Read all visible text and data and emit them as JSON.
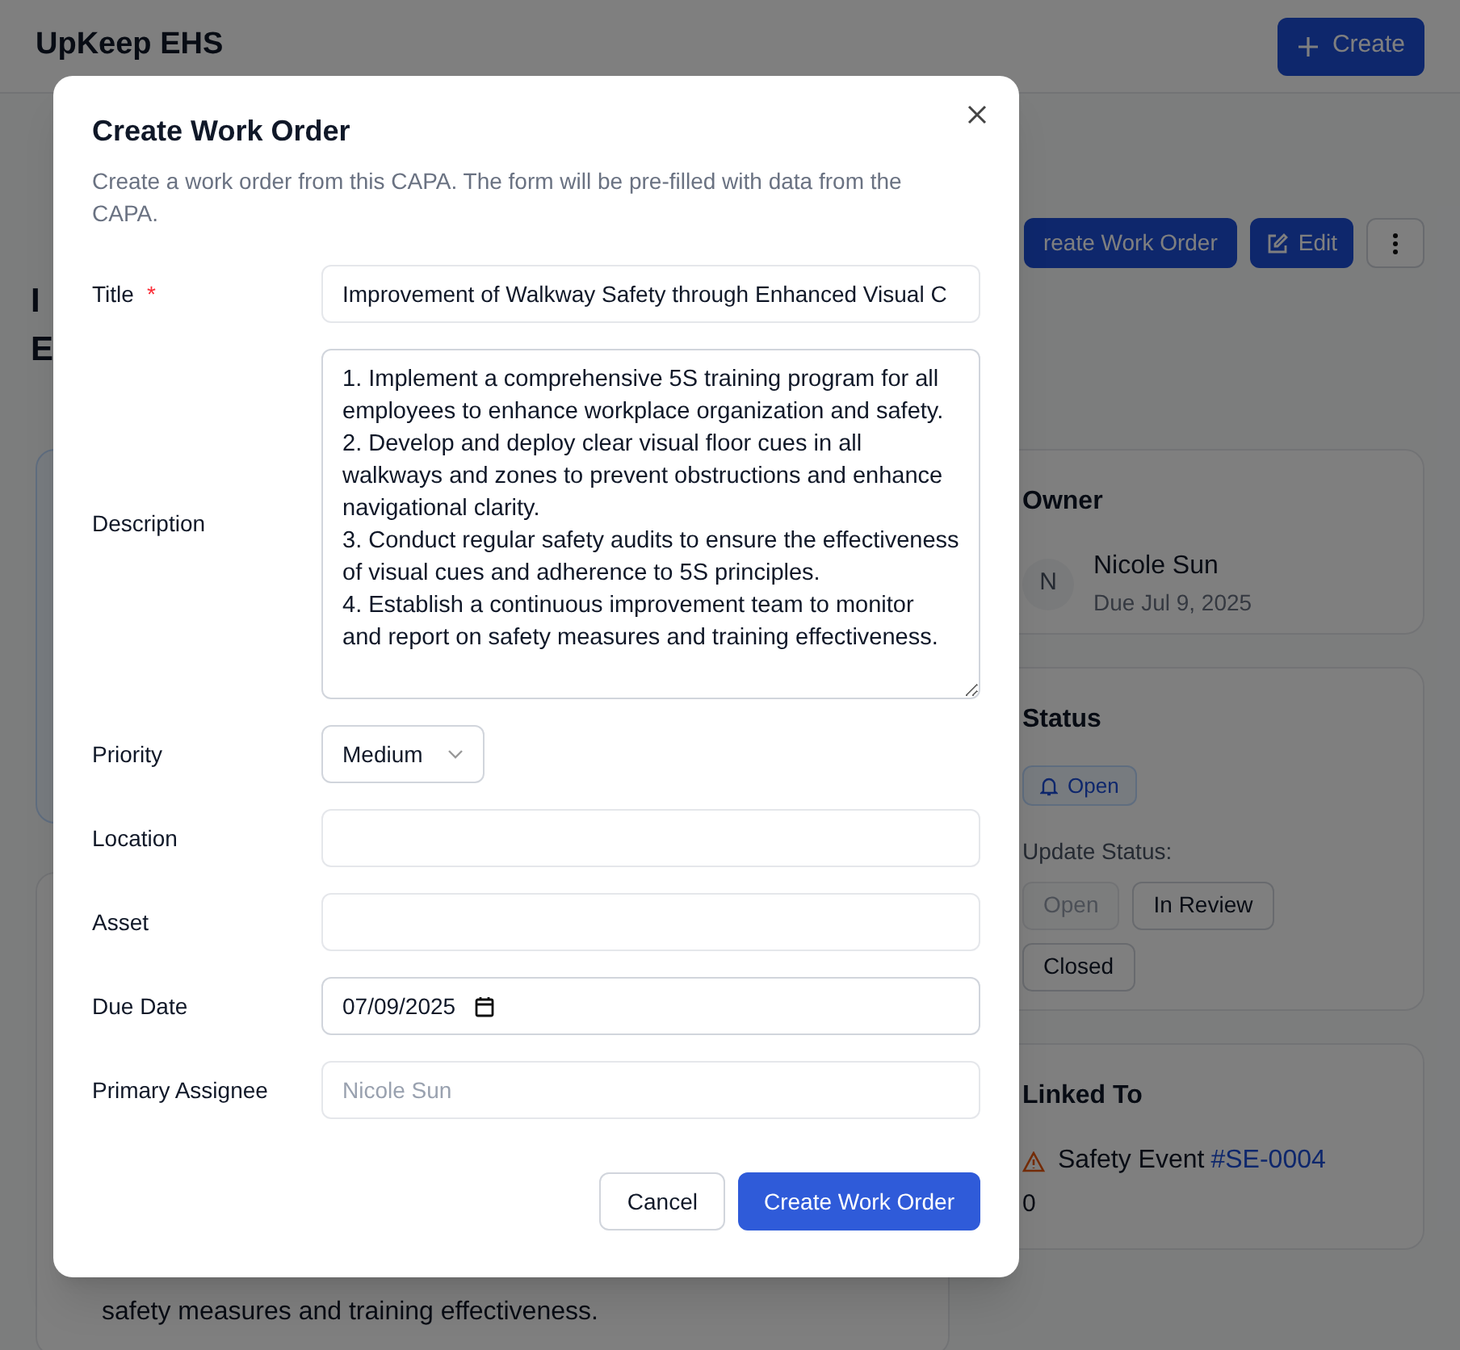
{
  "app": {
    "title": "UpKeep EHS",
    "create_button": "Create"
  },
  "background": {
    "toolbar_buttons": [
      {
        "kind": "primary",
        "label": "reate Work Order"
      },
      {
        "kind": "edit",
        "label": "Edit"
      },
      {
        "kind": "more"
      }
    ],
    "heading_lines": [
      "I",
      "E"
    ],
    "description_tail": "safety measures and training effectiveness.",
    "owner": {
      "title": "Owner",
      "initial": "N",
      "name": "Nicole Sun",
      "due": "Due Jul 9, 2025"
    },
    "status": {
      "title": "Status",
      "badge": "Open",
      "update_label": "Update Status:",
      "options": [
        {
          "label": "Open",
          "disabled": true
        },
        {
          "label": "In Review",
          "disabled": false
        },
        {
          "label": "Closed",
          "disabled": false
        }
      ]
    },
    "linked_to": {
      "title": "Linked To",
      "type": "Safety Event",
      "link": "#SE-0004",
      "extra": "0"
    }
  },
  "modal": {
    "title": "Create Work Order",
    "subtitle": "Create a work order from this CAPA. The form will be pre-filled with data from the CAPA.",
    "fields": [
      {
        "kind": "text",
        "label": "Title",
        "required_mark": "*",
        "value": "Improvement of Walkway Safety through Enhanced Visual C"
      },
      {
        "kind": "textarea",
        "label": "Description",
        "value": "1. Implement a comprehensive 5S training program for all employees to enhance workplace organization and safety.\n2. Develop and deploy clear visual floor cues in all walkways and zones to prevent obstructions and enhance navigational clarity.\n3. Conduct regular safety audits to ensure the effectiveness of visual cues and adherence to 5S principles.\n4. Establish a continuous improvement team to monitor and report on safety measures and training effectiveness."
      },
      {
        "kind": "select",
        "label": "Priority",
        "value": "Medium"
      },
      {
        "kind": "text",
        "label": "Location"
      },
      {
        "kind": "text",
        "label": "Asset"
      },
      {
        "kind": "date",
        "label": "Due Date",
        "value": "07/09/2025"
      },
      {
        "kind": "text",
        "label": "Primary Assignee",
        "placeholder": "Nicole Sun"
      }
    ],
    "buttons": [
      {
        "kind": "secondary",
        "label": "Cancel"
      },
      {
        "kind": "primary",
        "label": "Create Work Order"
      }
    ]
  }
}
